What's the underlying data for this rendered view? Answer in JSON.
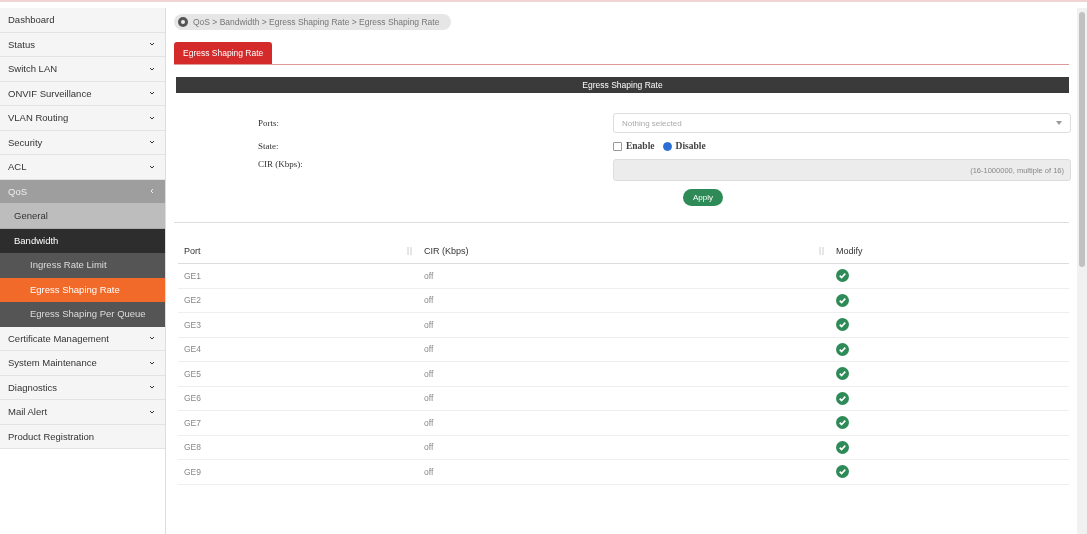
{
  "sidebar": {
    "items": [
      {
        "label": "Dashboard",
        "expandable": false,
        "expanded": false,
        "selected": false
      },
      {
        "label": "Status",
        "expandable": true,
        "expanded": false,
        "selected": false
      },
      {
        "label": "Switch LAN",
        "expandable": true,
        "expanded": false,
        "selected": false
      },
      {
        "label": "ONVIF Surveillance",
        "expandable": true,
        "expanded": false,
        "selected": false
      },
      {
        "label": "VLAN Routing",
        "expandable": true,
        "expanded": false,
        "selected": false
      },
      {
        "label": "Security",
        "expandable": true,
        "expanded": false,
        "selected": false
      },
      {
        "label": "ACL",
        "expandable": true,
        "expanded": false,
        "selected": false
      },
      {
        "label": "QoS",
        "expandable": true,
        "expanded": true,
        "selected": false,
        "children": [
          {
            "label": "General",
            "expanded": false,
            "selected": false
          },
          {
            "label": "Bandwidth",
            "expanded": true,
            "selected": false,
            "children": [
              {
                "label": "Ingress Rate Limit",
                "selected": false
              },
              {
                "label": "Egress Shaping Rate",
                "selected": true
              },
              {
                "label": "Egress Shaping Per Queue",
                "selected": false
              }
            ]
          }
        ]
      },
      {
        "label": "Certificate Management",
        "expandable": true,
        "expanded": false,
        "selected": false
      },
      {
        "label": "System Maintenance",
        "expandable": true,
        "expanded": false,
        "selected": false
      },
      {
        "label": "Diagnostics",
        "expandable": true,
        "expanded": false,
        "selected": false
      },
      {
        "label": "Mail Alert",
        "expandable": true,
        "expanded": false,
        "selected": false
      },
      {
        "label": "Product Registration",
        "expandable": false,
        "expanded": false,
        "selected": false
      }
    ]
  },
  "breadcrumb": "QoS > Bandwidth > Egress Shaping Rate > Egress Shaping Rate",
  "tabs": [
    {
      "label": "Egress Shaping Rate",
      "selected": true
    }
  ],
  "panel_title": "Egress Shaping Rate",
  "form": {
    "ports": {
      "label": "Ports:",
      "placeholder": "Nothing selected"
    },
    "state": {
      "label": "State:",
      "options": [
        {
          "label": "Enable",
          "selected": false
        },
        {
          "label": "Disable",
          "selected": true
        }
      ]
    },
    "cir": {
      "label": "CIR (Kbps):",
      "hint": "(16-1000000, multiple of 16)"
    },
    "apply": "Apply"
  },
  "table": {
    "columns": [
      {
        "label": "Port",
        "sortable": true
      },
      {
        "label": "CIR (Kbps)",
        "sortable": true
      },
      {
        "label": "Modify",
        "sortable": false
      }
    ],
    "rows": [
      {
        "port": "GE1",
        "cir": "off"
      },
      {
        "port": "GE2",
        "cir": "off"
      },
      {
        "port": "GE3",
        "cir": "off"
      },
      {
        "port": "GE4",
        "cir": "off"
      },
      {
        "port": "GE5",
        "cir": "off"
      },
      {
        "port": "GE6",
        "cir": "off"
      },
      {
        "port": "GE7",
        "cir": "off"
      },
      {
        "port": "GE8",
        "cir": "off"
      },
      {
        "port": "GE9",
        "cir": "off"
      }
    ]
  }
}
